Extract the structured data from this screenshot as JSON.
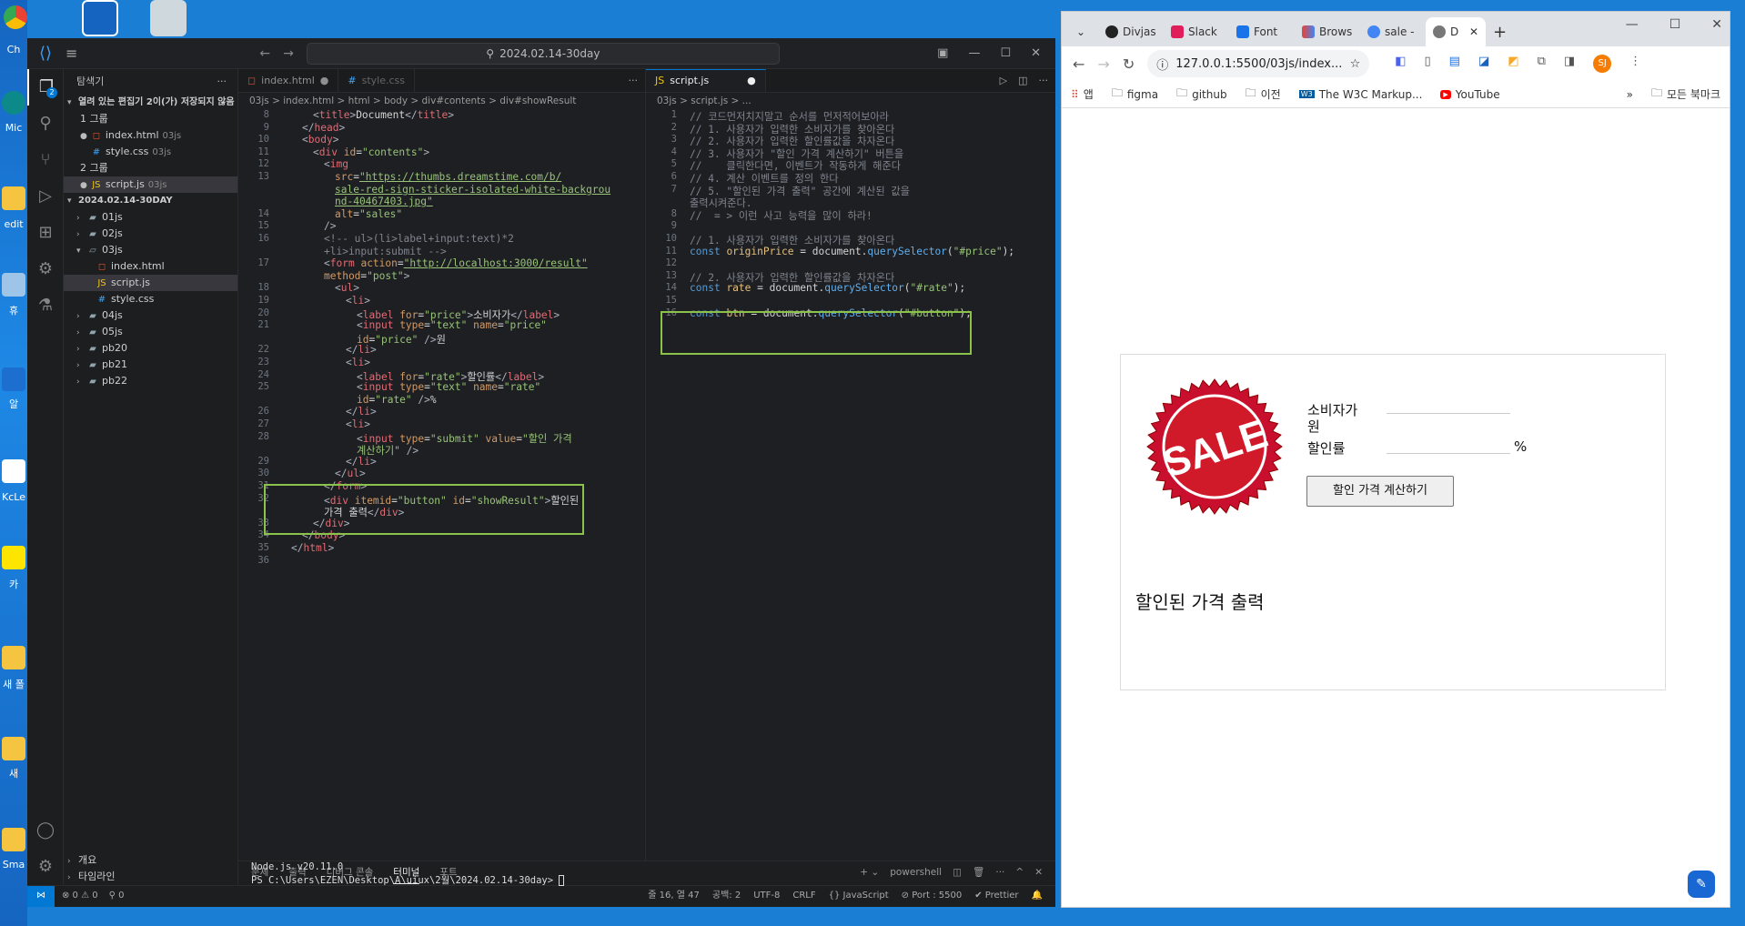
{
  "desktop": {
    "icons": [
      {
        "label": "Ch"
      },
      {
        "label": "Mic\nEd"
      },
      {
        "label": "edit\np"
      },
      {
        "label": "휴"
      },
      {
        "label": "알"
      },
      {
        "label": "KcLe\n세무"
      },
      {
        "label": "카"
      },
      {
        "label": "새 폴"
      },
      {
        "label": "새"
      },
      {
        "label": "Sma"
      }
    ]
  },
  "vscode": {
    "search": "2024.02.14-30day",
    "activity_badge": "2",
    "explorer": {
      "title": "탐색기",
      "open_editors": "열려 있는 편집기",
      "unsaved": "2이(가) 저장되지 않음",
      "group1": "1 그룹",
      "group2": "2 그룹",
      "g1_files": [
        {
          "name": "index.html",
          "dir": "03js"
        },
        {
          "name": "style.css",
          "dir": "03js"
        }
      ],
      "g2_files": [
        {
          "name": "script.js",
          "dir": "03js"
        }
      ],
      "workspace": "2024.02.14-30DAY",
      "folders": [
        "01js",
        "02js",
        "03js",
        "04js",
        "05js",
        "pb20",
        "pb21",
        "pb22"
      ],
      "js03_files": [
        "index.html",
        "script.js",
        "style.css"
      ],
      "outline": "개요",
      "timeline": "타임라인"
    },
    "left_tabs": [
      {
        "name": "index.html"
      },
      {
        "name": "style.css"
      }
    ],
    "left_breadcrumb": "03js > index.html > html > body > div#contents > div#showResult",
    "right_tabs": [
      {
        "name": "script.js"
      }
    ],
    "right_breadcrumb": "03js > script.js > ...",
    "html_lines": [
      {
        "n": "8",
        "html": "<span class='p'>&lt;</span><span class='t'>title</span><span class='p'>&gt;</span>Document<span class='p'>&lt;/</span><span class='t'>title</span><span class='p'>&gt;</span>",
        "indent": 3
      },
      {
        "n": "9",
        "html": "<span class='p'>&lt;/</span><span class='t'>head</span><span class='p'>&gt;</span>",
        "indent": 2
      },
      {
        "n": "10",
        "html": "<span class='p'>&lt;</span><span class='t'>body</span><span class='p'>&gt;</span>",
        "indent": 2
      },
      {
        "n": "11",
        "html": "<span class='p'>&lt;</span><span class='t'>div</span> <span class='a'>id</span>=<span class='s'>\"contents\"</span><span class='p'>&gt;</span>",
        "indent": 3
      },
      {
        "n": "12",
        "html": "<span class='p'>&lt;</span><span class='t'>img</span>",
        "indent": 4
      },
      {
        "n": "13",
        "html": "<span class='a'>src</span>=<span class='s u'>\"https://thumbs.dreamstime.com/b/</span>",
        "indent": 5
      },
      {
        "n": "",
        "html": "<span class='s u'>sale-red-sign-sticker-isolated-white-backgrou</span>",
        "indent": 5
      },
      {
        "n": "",
        "html": "<span class='s u'>nd-40467403.jpg\"</span>",
        "indent": 5
      },
      {
        "n": "14",
        "html": "<span class='a'>alt</span>=<span class='s'>\"sales\"</span>",
        "indent": 5
      },
      {
        "n": "15",
        "html": "<span class='p'>/&gt;</span>",
        "indent": 4
      },
      {
        "n": "16",
        "html": "<span class='c'>&lt;!-- ul&gt;(li&gt;label+input:text)*2</span>",
        "indent": 4
      },
      {
        "n": "",
        "html": "<span class='c'>+li&gt;input:submit --&gt;</span>",
        "indent": 4
      },
      {
        "n": "17",
        "html": "<span class='p'>&lt;</span><span class='t'>form</span> <span class='a'>action</span>=<span class='s u'>\"http://localhost:3000/result\"</span>",
        "indent": 4
      },
      {
        "n": "",
        "html": "<span class='a'>method</span>=<span class='s'>\"post\"</span><span class='p'>&gt;</span>",
        "indent": 4
      },
      {
        "n": "18",
        "html": "<span class='p'>&lt;</span><span class='t'>ul</span><span class='p'>&gt;</span>",
        "indent": 5
      },
      {
        "n": "19",
        "html": "<span class='p'>&lt;</span><span class='t'>li</span><span class='p'>&gt;</span>",
        "indent": 6
      },
      {
        "n": "20",
        "html": "<span class='p'>&lt;</span><span class='t'>label</span> <span class='a'>for</span>=<span class='s'>\"price\"</span><span class='p'>&gt;</span>소비자가<span class='p'>&lt;/</span><span class='t'>label</span><span class='p'>&gt;</span>",
        "indent": 7
      },
      {
        "n": "21",
        "html": "<span class='p'>&lt;</span><span class='t'>input</span> <span class='a'>type</span>=<span class='s'>\"text\"</span> <span class='a'>name</span>=<span class='s'>\"price\"</span>",
        "indent": 7
      },
      {
        "n": "",
        "html": "<span class='a'>id</span>=<span class='s'>\"price\"</span> <span class='p'>/&gt;</span>원",
        "indent": 7
      },
      {
        "n": "22",
        "html": "<span class='p'>&lt;/</span><span class='t'>li</span><span class='p'>&gt;</span>",
        "indent": 6
      },
      {
        "n": "23",
        "html": "<span class='p'>&lt;</span><span class='t'>li</span><span class='p'>&gt;</span>",
        "indent": 6
      },
      {
        "n": "24",
        "html": "<span class='p'>&lt;</span><span class='t'>label</span> <span class='a'>for</span>=<span class='s'>\"rate\"</span><span class='p'>&gt;</span>할인률<span class='p'>&lt;/</span><span class='t'>label</span><span class='p'>&gt;</span>",
        "indent": 7
      },
      {
        "n": "25",
        "html": "<span class='p'>&lt;</span><span class='t'>input</span> <span class='a'>type</span>=<span class='s'>\"text\"</span> <span class='a'>name</span>=<span class='s'>\"rate\"</span>",
        "indent": 7
      },
      {
        "n": "",
        "html": "<span class='a'>id</span>=<span class='s'>\"rate\"</span> <span class='p'>/&gt;</span>%",
        "indent": 7
      },
      {
        "n": "26",
        "html": "<span class='p'>&lt;/</span><span class='t'>li</span><span class='p'>&gt;</span>",
        "indent": 6
      },
      {
        "n": "27",
        "html": "<span class='p'>&lt;</span><span class='t'>li</span><span class='p'>&gt;</span>",
        "indent": 6
      },
      {
        "n": "28",
        "html": "<span class='p'>&lt;</span><span class='t'>input</span> <span class='a'>type</span>=<span class='s'>\"submit\"</span> <span class='a'>value</span>=<span class='s'>\"할인 가격</span>",
        "indent": 7
      },
      {
        "n": "",
        "html": "<span class='s'>계산하기\"</span> <span class='p'>/&gt;</span>",
        "indent": 7
      },
      {
        "n": "29",
        "html": "<span class='p'>&lt;/</span><span class='t'>li</span><span class='p'>&gt;</span>",
        "indent": 6
      },
      {
        "n": "30",
        "html": "<span class='p'>&lt;/</span><span class='t'>ul</span><span class='p'>&gt;</span>",
        "indent": 5
      },
      {
        "n": "31",
        "html": "<span class='p'>&lt;/</span><span class='t'>form</span><span class='p'>&gt;</span>",
        "indent": 4
      },
      {
        "n": "32",
        "html": "<span class='p'>&lt;</span><span class='t'>div</span> <span class='a'>itemid</span>=<span class='s'>\"button\"</span> <span class='a'>id</span>=<span class='s'>\"showResult\"</span><span class='p'>&gt;</span>할인된",
        "indent": 4
      },
      {
        "n": "",
        "html": "가격 출력<span class='p'>&lt;/</span><span class='t'>div</span><span class='p'>&gt;</span>",
        "indent": 4
      },
      {
        "n": "33",
        "html": "<span class='p'>&lt;/</span><span class='t'>div</span><span class='p'>&gt;</span>",
        "indent": 3
      },
      {
        "n": "34",
        "html": "<span class='p'>&lt;/</span><span class='t'>body</span><span class='p'>&gt;</span>",
        "indent": 2
      },
      {
        "n": "35",
        "html": "<span class='p'>&lt;/</span><span class='t'>html</span><span class='p'>&gt;</span>",
        "indent": 1
      },
      {
        "n": "36",
        "html": "",
        "indent": 0
      }
    ],
    "js_lines": [
      {
        "n": "1",
        "html": "<span class='c'>// 코드먼저치지말고 순서를 먼저적어보아라</span>"
      },
      {
        "n": "2",
        "html": "<span class='c'>// 1. 사용자가 입력한 소비자가를 찾아온다</span>"
      },
      {
        "n": "3",
        "html": "<span class='c'>// 2. 사용자가 입력한 할인률값을 차자온다</span>"
      },
      {
        "n": "4",
        "html": "<span class='c'>// 3. 사용자가 \"할인 가격 계산하기\" 버튼을</span>"
      },
      {
        "n": "5",
        "html": "<span class='c'>//    클릭한다면, 이벤트가 작동하게 해준다</span>"
      },
      {
        "n": "6",
        "html": "<span class='c'>// 4. 계산 이벤트를 정의 한다</span>"
      },
      {
        "n": "7",
        "html": "<span class='c'>// 5. \"할인된 가격 출력\" 공간에 계산된 값을</span>"
      },
      {
        "n": "",
        "html": "<span class='c'>출력시켜준다.</span>"
      },
      {
        "n": "8",
        "html": "<span class='c'>//  = &gt; 이런 사고 능력을 많이 하라!</span>"
      },
      {
        "n": "9",
        "html": ""
      },
      {
        "n": "10",
        "html": "<span class='c'>// 1. 사용자가 입력한 소비자가를 찾아온다</span>"
      },
      {
        "n": "11",
        "html": "<span class='k'>const</span> <span class='v'>originPrice</span> = document.<span class='fn'>querySelector</span>(<span class='s'>\"#price\"</span>);"
      },
      {
        "n": "12",
        "html": ""
      },
      {
        "n": "13",
        "html": "<span class='c'>// 2. 사용자가 입력한 할인률값을 차자온다</span>"
      },
      {
        "n": "14",
        "html": "<span class='k'>const</span> <span class='v'>rate</span> = document.<span class='fn'>querySelector</span>(<span class='s'>\"#rate\"</span>);"
      },
      {
        "n": "15",
        "html": ""
      },
      {
        "n": "16",
        "html": "<span class='k'>const</span> <span class='v'>btn</span> = document.<span class='fn'>querySelector</span>(<span class='s'>\"#button\"</span>);"
      }
    ],
    "panel_tabs": [
      "문제",
      "출력",
      "디버그 콘솔",
      "터미널",
      "포트"
    ],
    "panel_active": "터미널",
    "terminal_shell": "powershell",
    "terminal_lines": [
      "Node.js v20.11.0",
      "PS C:\\Users\\EZEN\\Desktop\\A\\uiux\\2월\\2024.02.14-30day> "
    ],
    "status": {
      "problems": "⊗ 0 ⚠ 0",
      "ports": "⚲ 0",
      "cursor": "줄 16, 열 47",
      "spaces": "공백: 2",
      "encoding": "UTF-8",
      "eol": "CRLF",
      "language": "{} JavaScript",
      "port": "⊘ Port : 5500",
      "prettier": "✔ Prettier"
    }
  },
  "chrome": {
    "tabs": [
      {
        "title": "Divjas",
        "color": "#222"
      },
      {
        "title": "Slack",
        "color": "#e01e5a"
      },
      {
        "title": "Font",
        "color": "#1a73e8"
      },
      {
        "title": "Brows",
        "color": "#ea4335"
      },
      {
        "title": "sale -",
        "color": "#4285f4"
      },
      {
        "title": "D",
        "color": "#555"
      }
    ],
    "url": "127.0.0.1:5500/03js/index....",
    "bookmarks": [
      "앱",
      "figma",
      "github",
      "이전",
      "The W3C Markup...",
      "YouTube"
    ],
    "all_bookmarks": "모든 북마크",
    "profile": "SJ",
    "page": {
      "sale_text": "SALE",
      "price_label": "소비자가",
      "price_unit": "원",
      "rate_label": "할인률",
      "rate_unit": "%",
      "button": "할인 가격 계산하기",
      "result": "할인된 가격 출력"
    }
  }
}
